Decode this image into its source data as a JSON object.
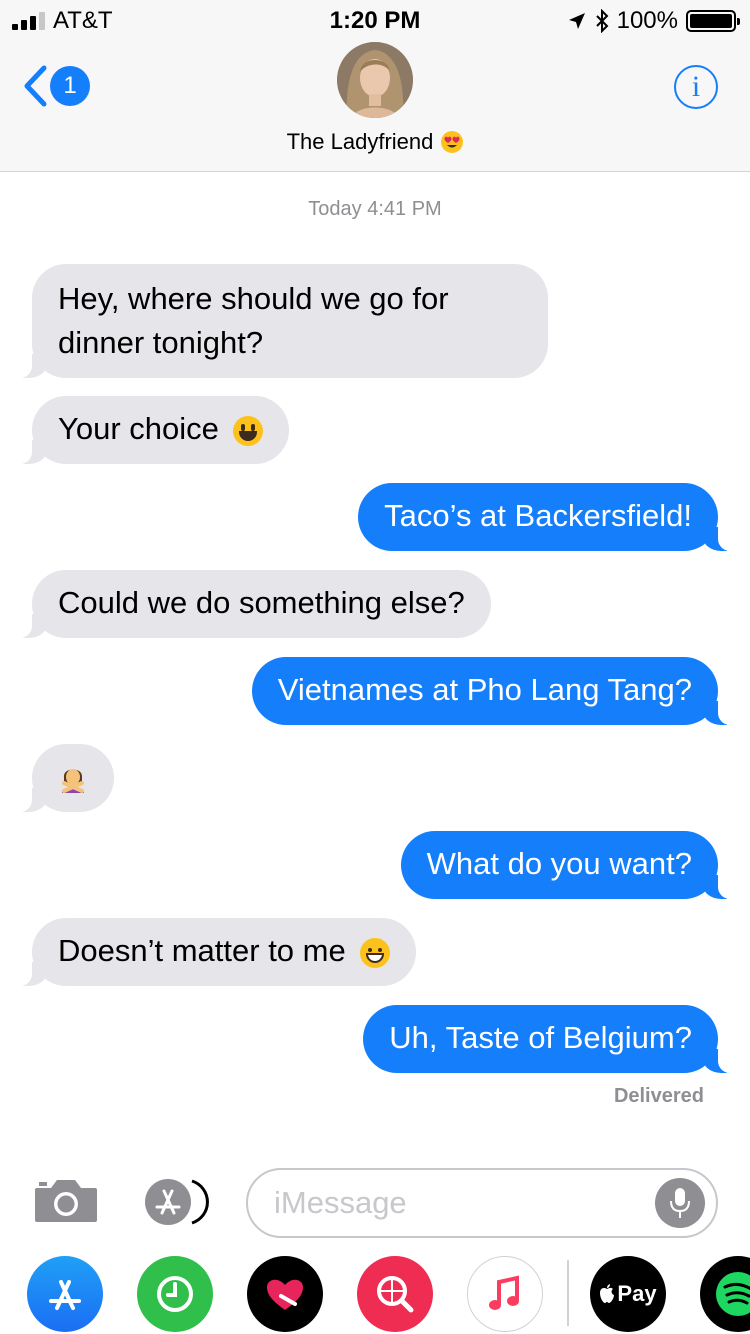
{
  "status_bar": {
    "carrier": "AT&T",
    "time": "1:20 PM",
    "battery": "100%"
  },
  "header": {
    "back_badge": "1",
    "contact_name": "The Ladyfriend",
    "info_glyph": "i"
  },
  "conversation": {
    "timestamp": "Today 4:41 PM",
    "messages": [
      {
        "from": "them",
        "line1": "Hey, where should we go for",
        "line2": "dinner tonight?"
      },
      {
        "from": "them",
        "text": "Your choice",
        "emoji": "smiley-emoji"
      },
      {
        "from": "me",
        "text": "Taco’s at Backersfield!"
      },
      {
        "from": "them",
        "text": "Could we do something else?"
      },
      {
        "from": "me",
        "text": "Vietnames at Pho Lang Tang?"
      },
      {
        "from": "them",
        "emoji": "woman-gesturing-no-emoji"
      },
      {
        "from": "me",
        "text": "What do you want?"
      },
      {
        "from": "them",
        "text": "Doesn’t matter to me",
        "emoji": "grinning-emoji"
      },
      {
        "from": "me",
        "text": "Uh, Taste of Belgium?"
      }
    ],
    "delivered": "Delivered"
  },
  "compose": {
    "placeholder": "iMessage",
    "value": ""
  },
  "app_drawer": {
    "apps": [
      "app-store-icon",
      "activity-icon",
      "digital-touch-icon",
      "images-search-icon",
      "music-icon",
      "apple-pay-icon",
      "spotify-icon"
    ],
    "apple_pay_label": "Pay"
  },
  "colors": {
    "accent": "#147efb",
    "incoming_bubble": "#e5e5ea",
    "header_bg": "#f7f7f7",
    "secondary_text": "#8e8e93"
  }
}
